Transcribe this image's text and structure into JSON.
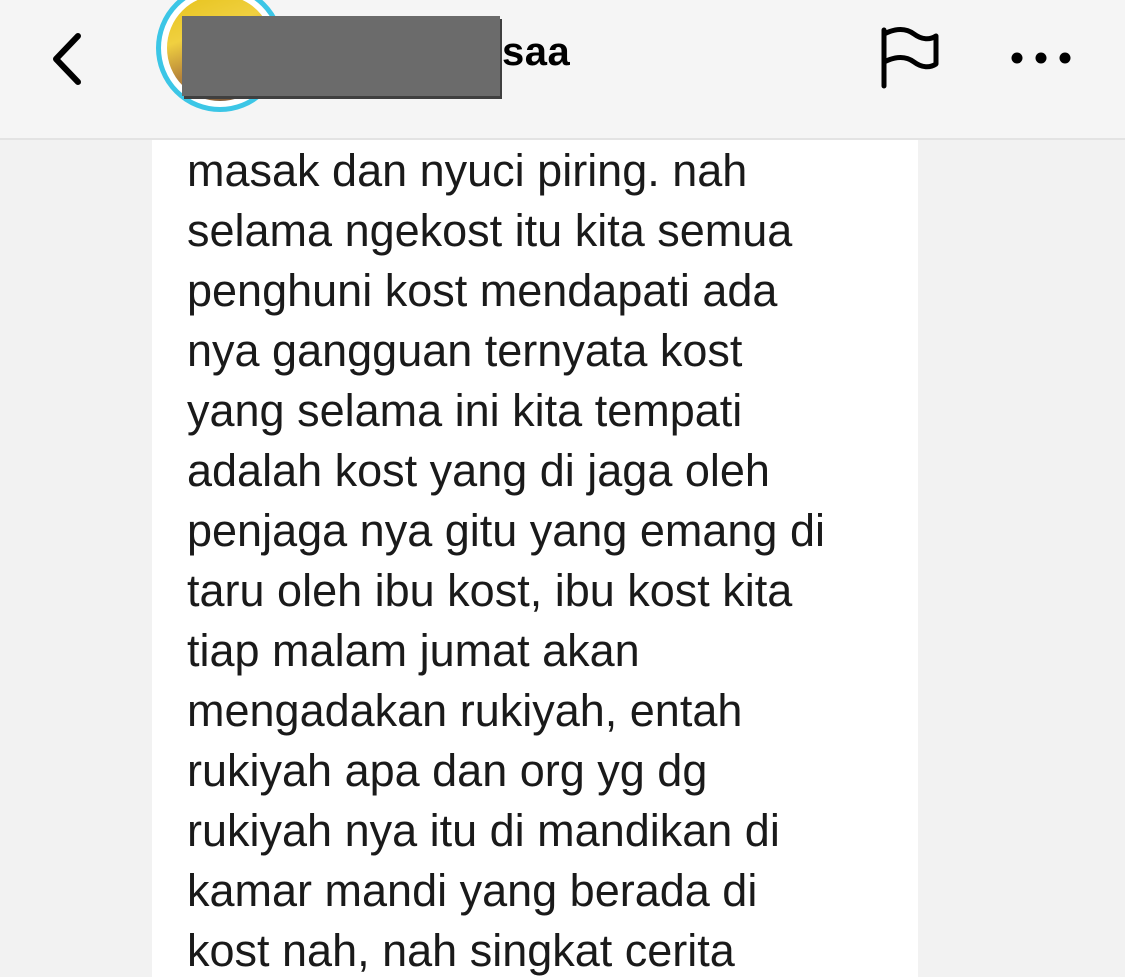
{
  "header": {
    "username_visible": "saa",
    "back_icon": "chevron-left-icon",
    "flag_icon": "flag-icon",
    "more_icon": "more-horizontal-icon"
  },
  "message": {
    "lines": [
      "masak dan nyuci piring. nah",
      "selama ngekost itu kita semua",
      "penghuni kost mendapati ada",
      "nya gangguan ternyata kost",
      "yang selama ini kita tempati",
      "adalah kost yang di jaga oleh",
      "penjaga nya gitu yang emang di",
      "taru oleh ibu kost, ibu kost kita",
      "tiap malam jumat akan",
      "mengadakan rukiyah, entah",
      "rukiyah apa dan org yg dg",
      "rukiyah nya itu di mandikan di",
      "kamar mandi yang berada di",
      "kost nah, nah singkat cerita"
    ]
  }
}
